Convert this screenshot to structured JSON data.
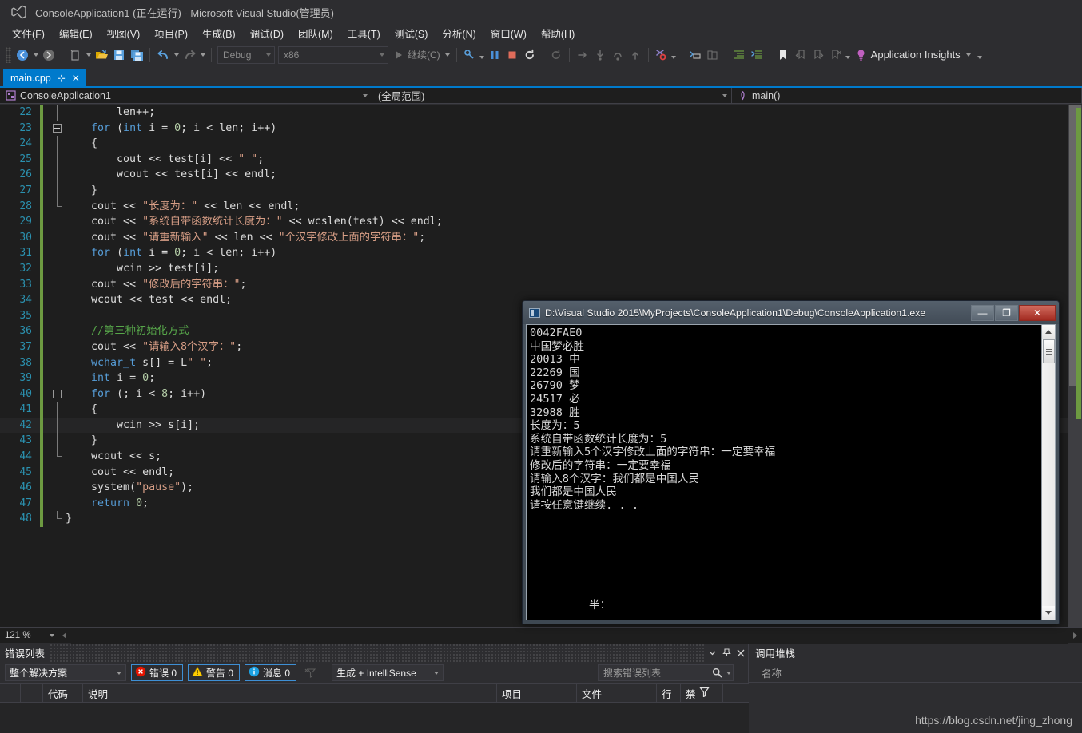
{
  "window": {
    "title": "ConsoleApplication1 (正在运行) - Microsoft Visual Studio(管理员)"
  },
  "menubar": {
    "items": [
      {
        "label": "文件(F)"
      },
      {
        "label": "编辑(E)"
      },
      {
        "label": "视图(V)"
      },
      {
        "label": "项目(P)"
      },
      {
        "label": "生成(B)"
      },
      {
        "label": "调试(D)"
      },
      {
        "label": "团队(M)"
      },
      {
        "label": "工具(T)"
      },
      {
        "label": "测试(S)"
      },
      {
        "label": "分析(N)"
      },
      {
        "label": "窗口(W)"
      },
      {
        "label": "帮助(H)"
      }
    ]
  },
  "toolbar": {
    "config": "Debug",
    "platform": "x86",
    "continue_label": "继续(C)",
    "app_insights_label": "Application Insights"
  },
  "tabs": {
    "active": {
      "label": "main.cpp",
      "pin": "⊹",
      "close": "✕"
    }
  },
  "navbar": {
    "project": "ConsoleApplication1",
    "scope": "(全局范围)",
    "member": "main()"
  },
  "editor": {
    "zoom": "121 %",
    "lines": [
      {
        "num": "22",
        "outline": "line",
        "indent": 4,
        "tokens": [
          {
            "t": "        ",
            "c": "p"
          },
          {
            "t": "len",
            "c": "p"
          },
          {
            "t": "++;",
            "c": "p"
          }
        ]
      },
      {
        "num": "23",
        "outline": "box",
        "tokens": [
          {
            "t": "    ",
            "c": "p"
          },
          {
            "t": "for",
            "c": "k"
          },
          {
            "t": " (",
            "c": "p"
          },
          {
            "t": "int",
            "c": "k"
          },
          {
            "t": " i = ",
            "c": "p"
          },
          {
            "t": "0",
            "c": "n"
          },
          {
            "t": "; i < len; i++)",
            "c": "p"
          }
        ]
      },
      {
        "num": "24",
        "outline": "line",
        "tokens": [
          {
            "t": "    {",
            "c": "p"
          }
        ]
      },
      {
        "num": "25",
        "outline": "line",
        "tokens": [
          {
            "t": "        cout << test[i] << ",
            "c": "p"
          },
          {
            "t": "\" \"",
            "c": "s"
          },
          {
            "t": ";",
            "c": "p"
          }
        ]
      },
      {
        "num": "26",
        "outline": "line",
        "tokens": [
          {
            "t": "        wcout << test[i] << endl;",
            "c": "p"
          }
        ]
      },
      {
        "num": "27",
        "outline": "line",
        "tokens": [
          {
            "t": "    }",
            "c": "p"
          }
        ]
      },
      {
        "num": "28",
        "outline": "end",
        "tokens": [
          {
            "t": "    cout << ",
            "c": "p"
          },
          {
            "t": "\"长度为：\"",
            "c": "s"
          },
          {
            "t": " << len << endl;",
            "c": "p"
          }
        ]
      },
      {
        "num": "29",
        "outline": "none",
        "tokens": [
          {
            "t": "    cout << ",
            "c": "p"
          },
          {
            "t": "\"系统自带函数统计长度为：\"",
            "c": "s"
          },
          {
            "t": " << wcslen(test) << endl;",
            "c": "p"
          }
        ]
      },
      {
        "num": "30",
        "outline": "none",
        "tokens": [
          {
            "t": "    cout << ",
            "c": "p"
          },
          {
            "t": "\"请重新输入\"",
            "c": "s"
          },
          {
            "t": " << len << ",
            "c": "p"
          },
          {
            "t": "\"个汉字修改上面的字符串：\"",
            "c": "s"
          },
          {
            "t": ";",
            "c": "p"
          }
        ]
      },
      {
        "num": "31",
        "outline": "none",
        "tokens": [
          {
            "t": "    ",
            "c": "p"
          },
          {
            "t": "for",
            "c": "k"
          },
          {
            "t": " (",
            "c": "p"
          },
          {
            "t": "int",
            "c": "k"
          },
          {
            "t": " i = ",
            "c": "p"
          },
          {
            "t": "0",
            "c": "n"
          },
          {
            "t": "; i < len; i++)",
            "c": "p"
          }
        ]
      },
      {
        "num": "32",
        "outline": "none",
        "tokens": [
          {
            "t": "        wcin >> test[i];",
            "c": "p"
          }
        ]
      },
      {
        "num": "33",
        "outline": "none",
        "tokens": [
          {
            "t": "    cout << ",
            "c": "p"
          },
          {
            "t": "\"修改后的字符串：\"",
            "c": "s"
          },
          {
            "t": ";",
            "c": "p"
          }
        ]
      },
      {
        "num": "34",
        "outline": "none",
        "tokens": [
          {
            "t": "    wcout << test << endl;",
            "c": "p"
          }
        ]
      },
      {
        "num": "35",
        "outline": "none",
        "tokens": [
          {
            "t": "",
            "c": "p"
          }
        ]
      },
      {
        "num": "36",
        "outline": "none",
        "tokens": [
          {
            "t": "    ",
            "c": "p"
          },
          {
            "t": "//第三种初始化方式",
            "c": "c"
          }
        ]
      },
      {
        "num": "37",
        "outline": "none",
        "tokens": [
          {
            "t": "    cout << ",
            "c": "p"
          },
          {
            "t": "\"请输入8个汉字：\"",
            "c": "s"
          },
          {
            "t": ";",
            "c": "p"
          }
        ]
      },
      {
        "num": "38",
        "outline": "none",
        "tokens": [
          {
            "t": "    ",
            "c": "p"
          },
          {
            "t": "wchar_t",
            "c": "k"
          },
          {
            "t": " s[] = L",
            "c": "p"
          },
          {
            "t": "\" \"",
            "c": "s"
          },
          {
            "t": ";",
            "c": "p"
          }
        ]
      },
      {
        "num": "39",
        "outline": "none",
        "tokens": [
          {
            "t": "    ",
            "c": "p"
          },
          {
            "t": "int",
            "c": "k"
          },
          {
            "t": " i = ",
            "c": "p"
          },
          {
            "t": "0",
            "c": "n"
          },
          {
            "t": ";",
            "c": "p"
          }
        ]
      },
      {
        "num": "40",
        "outline": "box",
        "tokens": [
          {
            "t": "    ",
            "c": "p"
          },
          {
            "t": "for",
            "c": "k"
          },
          {
            "t": " (; i < ",
            "c": "p"
          },
          {
            "t": "8",
            "c": "n"
          },
          {
            "t": "; i++)",
            "c": "p"
          }
        ]
      },
      {
        "num": "41",
        "outline": "line",
        "tokens": [
          {
            "t": "    {",
            "c": "p"
          }
        ]
      },
      {
        "num": "42",
        "outline": "line",
        "current": true,
        "tokens": [
          {
            "t": "        wcin >> s[i];",
            "c": "p"
          }
        ]
      },
      {
        "num": "43",
        "outline": "line",
        "tokens": [
          {
            "t": "    }",
            "c": "p"
          }
        ]
      },
      {
        "num": "44",
        "outline": "end",
        "tokens": [
          {
            "t": "    wcout << s;",
            "c": "p"
          }
        ]
      },
      {
        "num": "45",
        "outline": "none",
        "tokens": [
          {
            "t": "    cout << endl;",
            "c": "p"
          }
        ]
      },
      {
        "num": "46",
        "outline": "none",
        "tokens": [
          {
            "t": "    system(",
            "c": "p"
          },
          {
            "t": "\"pause\"",
            "c": "s"
          },
          {
            "t": ");",
            "c": "p"
          }
        ]
      },
      {
        "num": "47",
        "outline": "none",
        "tokens": [
          {
            "t": "    ",
            "c": "p"
          },
          {
            "t": "return",
            "c": "k"
          },
          {
            "t": " ",
            "c": "p"
          },
          {
            "t": "0",
            "c": "n"
          },
          {
            "t": ";",
            "c": "p"
          }
        ]
      },
      {
        "num": "48",
        "outline": "close",
        "tokens": [
          {
            "t": "}",
            "c": "p"
          }
        ]
      }
    ]
  },
  "console": {
    "title": "D:\\Visual Studio 2015\\MyProjects\\ConsoleApplication1\\Debug\\ConsoleApplication1.exe",
    "minimize": "—",
    "maximize": "❐",
    "close": "✕",
    "output": [
      "0042FAE0",
      "中国梦必胜",
      "20013 中",
      "22269 国",
      "26790 梦",
      "24517 必",
      "32988 胜",
      "长度为：5",
      "系统自带函数统计长度为：5",
      "请重新输入5个汉字修改上面的字符串：一定要幸福",
      "修改后的字符串：一定要幸福",
      "请输入8个汉字：我们都是中国人民",
      "我们都是中国人民",
      "请按任意键继续. . ."
    ],
    "prompt": "半："
  },
  "error_list": {
    "title": "错误列表",
    "scope": "整个解决方案",
    "chips": [
      {
        "icon": "error-icon",
        "label": "错误 0"
      },
      {
        "icon": "warning-icon",
        "label": "警告 0"
      },
      {
        "icon": "info-icon",
        "label": "消息 0"
      }
    ],
    "build_filter": "生成 + IntelliSense",
    "search_placeholder": "搜索错误列表",
    "columns": [
      "",
      "",
      "代码",
      "说明",
      "项目",
      "文件",
      "行",
      "禁"
    ],
    "rows": []
  },
  "call_stack": {
    "title": "调用堆栈",
    "column": "名称",
    "rows": []
  },
  "watermark": "https://blog.csdn.net/jing_zhong",
  "colors": {
    "accent": "#007acc",
    "editor_bg": "#1e1e1e",
    "chrome_bg": "#2d2d30",
    "string": "#d69d85",
    "keyword": "#569cd6",
    "comment": "#57a64a",
    "number": "#b5cea8",
    "linenum": "#2b91af",
    "change_bar": "#6d9a41",
    "error_red": "#e51400",
    "warning_yellow": "#ffcc00",
    "info_blue": "#1ba1e2"
  }
}
